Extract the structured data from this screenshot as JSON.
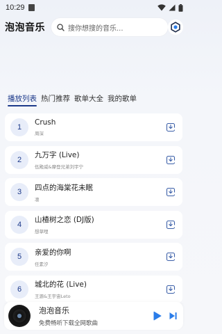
{
  "status": {
    "time": "10:29"
  },
  "header": {
    "title": "泡泡音乐",
    "search_placeholder": "搜你想搜的音乐..."
  },
  "tabs": [
    {
      "label": "播放列表",
      "active": true
    },
    {
      "label": "热门推荐",
      "active": false
    },
    {
      "label": "歌单大全",
      "active": false
    },
    {
      "label": "我的歌单",
      "active": false
    }
  ],
  "songs": [
    {
      "num": "1",
      "title": "Crush",
      "artist": "周深"
    },
    {
      "num": "2",
      "title": "九万字 (Live)",
      "artist": "伍殿威&摩登兄弟刘宇宁"
    },
    {
      "num": "3",
      "title": "四点的海棠花未眠",
      "artist": "凛"
    },
    {
      "num": "4",
      "title": "山楂树之恋 (DJ版)",
      "artist": "想草哩"
    },
    {
      "num": "5",
      "title": "亲爱的你啊",
      "artist": "任素汐"
    },
    {
      "num": "6",
      "title": "城北的花 (Live)",
      "artist": "王源&王宇宙Leto"
    }
  ],
  "player": {
    "title": "泡泡音乐",
    "subtitle": "免费畅听下载全网歌曲"
  },
  "colors": {
    "accent": "#1d3a8a",
    "play": "#2b7de9"
  }
}
